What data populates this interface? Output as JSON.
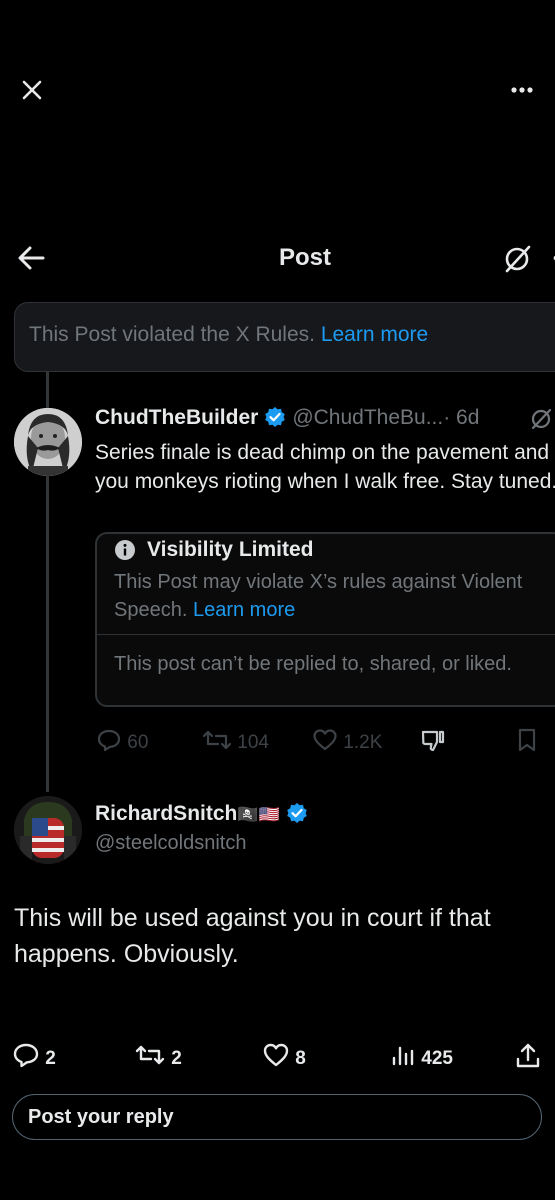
{
  "header": {
    "title": "Post"
  },
  "banner": {
    "text": "This Post violated the X Rules.",
    "link": "Learn more"
  },
  "post": {
    "name": "ChudTheBuilder",
    "handle": "@ChudTheBu...",
    "time": "· 6d",
    "text": "Series finale is dead chimp on the pavement and you monkeys rioting when I walk free. Stay tuned.",
    "notice": {
      "title": "Visibility Limited",
      "body": "This Post may violate X’s rules against Violent Speech.",
      "link": "Learn more",
      "body2": "This post can’t be replied to, shared, or liked."
    },
    "actions": {
      "replies": "60",
      "reposts": "104",
      "likes": "1.2K"
    }
  },
  "reply": {
    "name": "RichardSnitch",
    "name_emoji": "🏴‍☠️🇺🇸",
    "handle": "@steelcoldsnitch",
    "text": "This will be used against you in court if that happens. Obviously.",
    "actions": {
      "replies": "2",
      "reposts": "2",
      "likes": "8",
      "views": "425"
    }
  },
  "composer": {
    "placeholder": "Post your reply"
  },
  "colors": {
    "background": "#000000",
    "accent": "#1d9bf0",
    "muted": "#71767b",
    "border": "#2f3336"
  }
}
